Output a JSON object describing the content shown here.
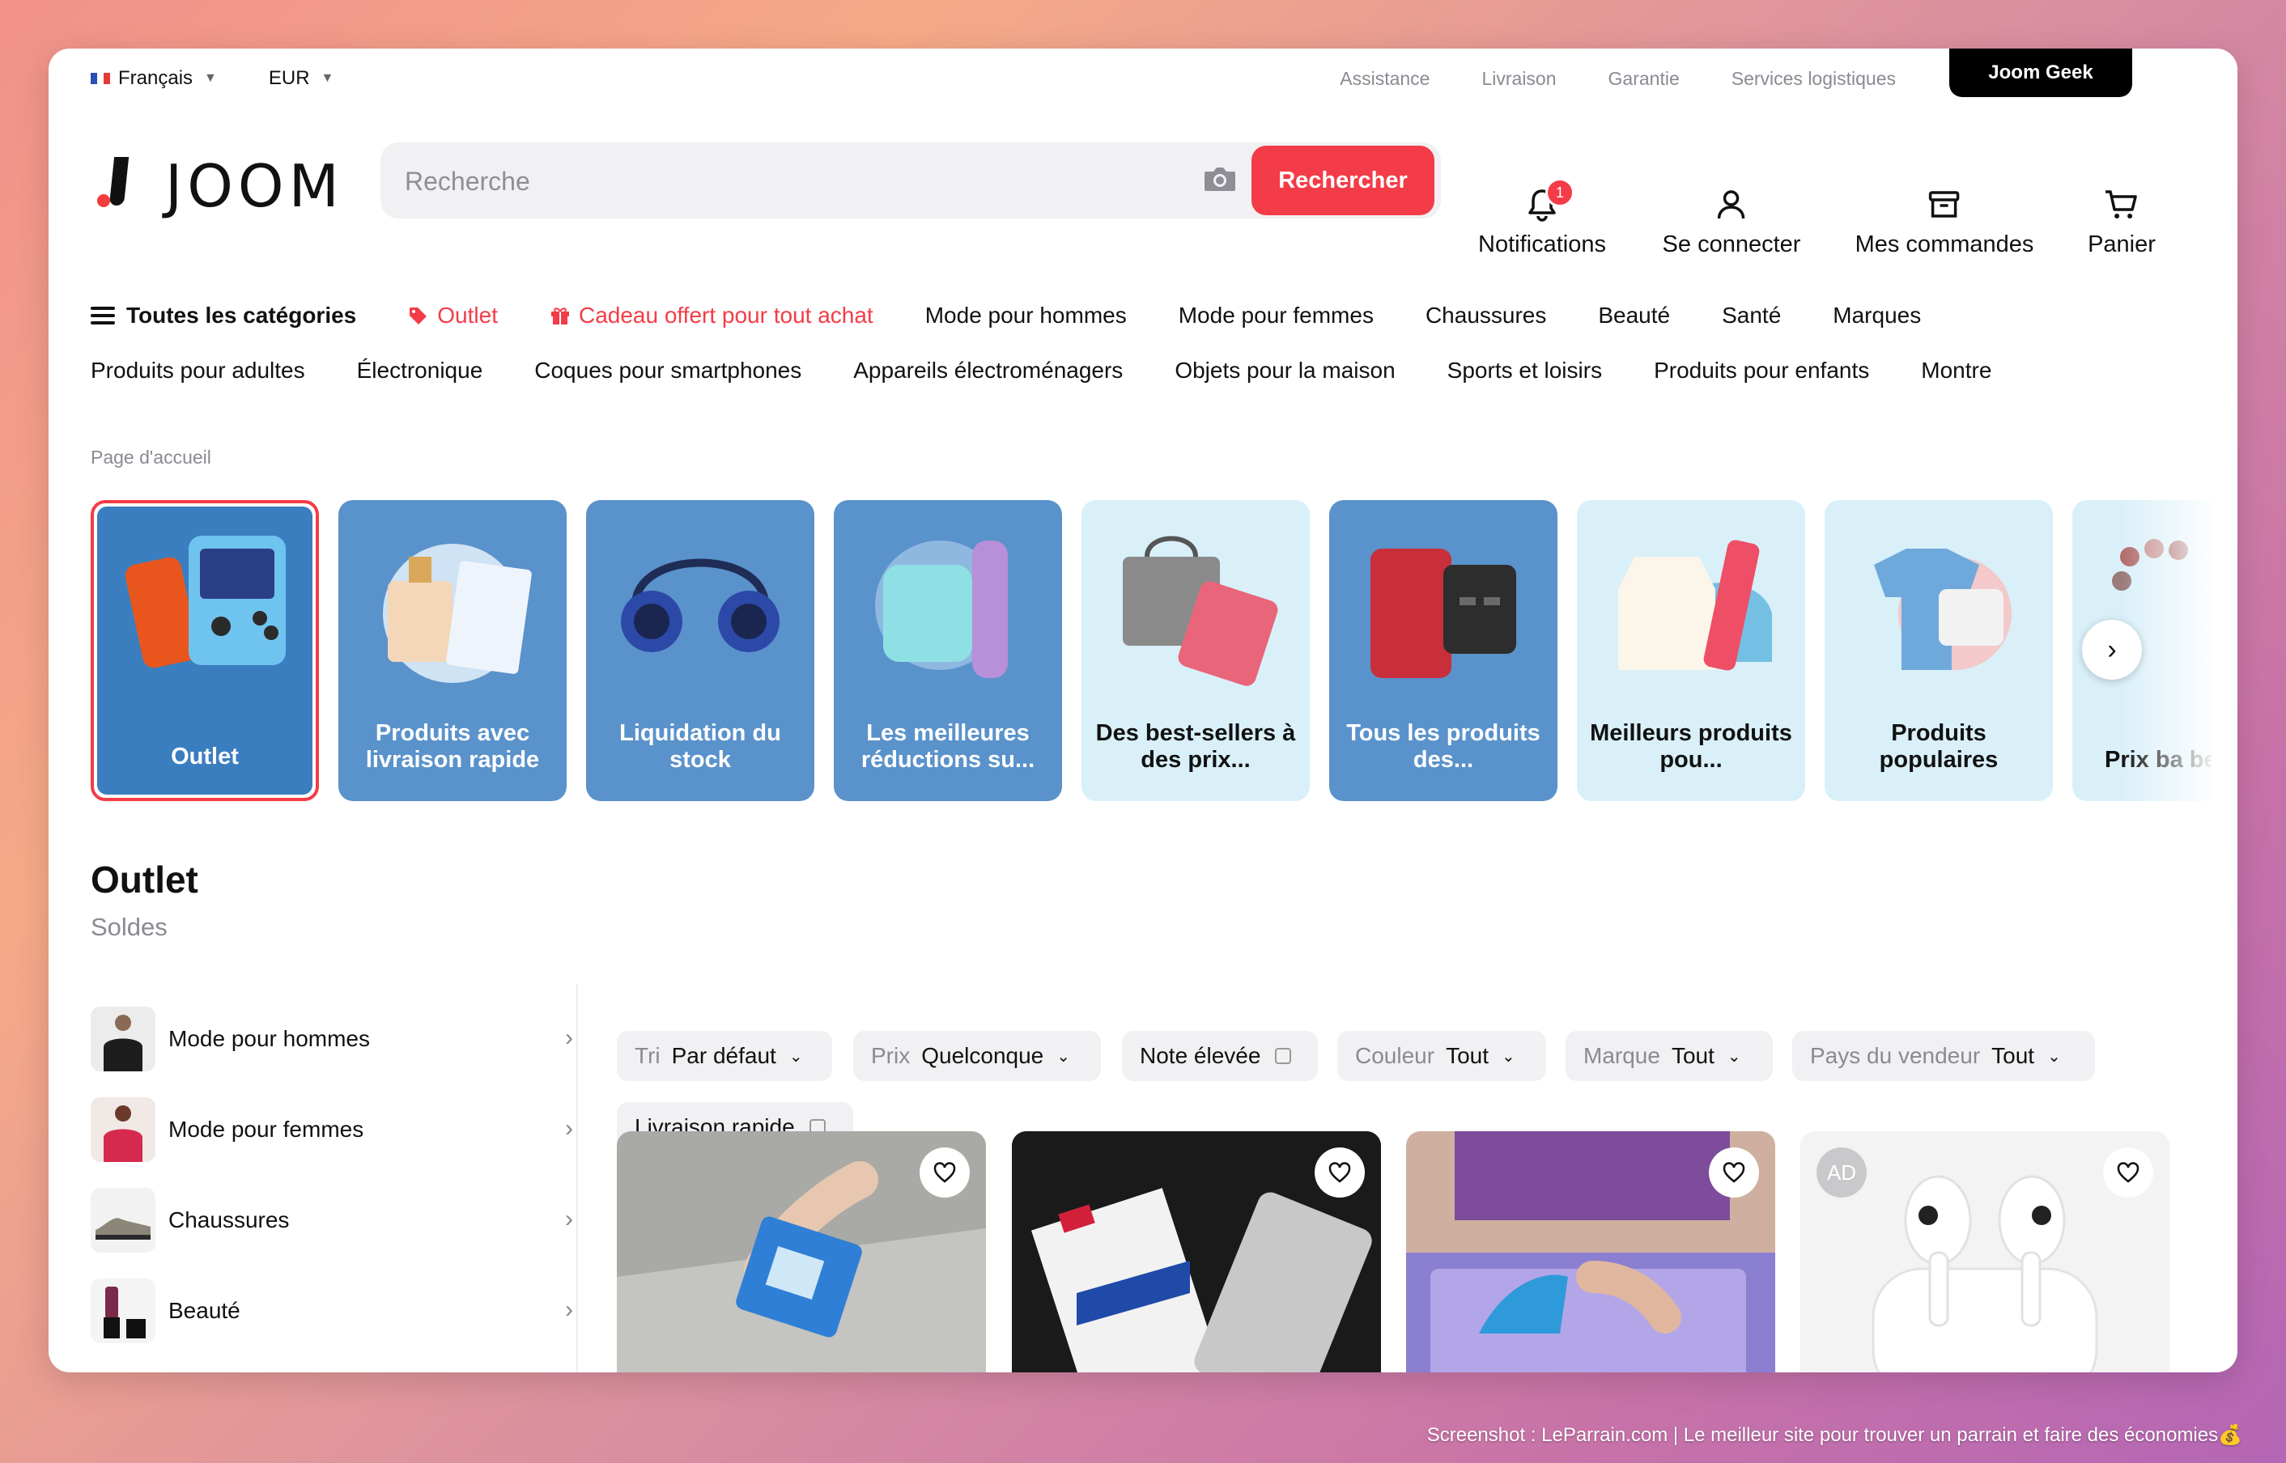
{
  "topbar": {
    "language": "Français",
    "currency": "EUR",
    "links": [
      "Assistance",
      "Livraison",
      "Garantie",
      "Services logistiques"
    ],
    "geek_label": "Joom Geek"
  },
  "header": {
    "logo_text": "JOOM",
    "search_placeholder": "Recherche",
    "search_button": "Rechercher",
    "notifications_label": "Notifications",
    "notifications_count": "1",
    "login_label": "Se connecter",
    "orders_label": "Mes commandes",
    "cart_label": "Panier"
  },
  "nav_row1": {
    "all_categories": "Toutes les catégories",
    "outlet": "Outlet",
    "gift": "Cadeau offert pour tout achat",
    "items": [
      "Mode pour hommes",
      "Mode pour femmes",
      "Chaussures",
      "Beauté",
      "Santé",
      "Marques"
    ]
  },
  "nav_row2": [
    "Produits pour adultes",
    "Électronique",
    "Coques pour smartphones",
    "Appareils électroménagers",
    "Objets pour la maison",
    "Sports et loisirs",
    "Produits pour enfants",
    "Montre"
  ],
  "breadcrumb": "Page d'accueil",
  "tiles": [
    {
      "label": "Outlet",
      "bg": "#3a7ec0",
      "fg": "#ffffff"
    },
    {
      "label": "Produits avec livraison rapide",
      "bg": "#5a92cb",
      "fg": "#ffffff"
    },
    {
      "label": "Liquidation du stock",
      "bg": "#5a92cb",
      "fg": "#ffffff"
    },
    {
      "label": "Les meilleures réductions su...",
      "bg": "#5a92cb",
      "fg": "#ffffff"
    },
    {
      "label": "Des best-sellers à des prix...",
      "bg": "#d9f0f9",
      "fg": "#111111"
    },
    {
      "label": "Tous les produits des...",
      "bg": "#5a92cb",
      "fg": "#ffffff"
    },
    {
      "label": "Meilleurs produits pou...",
      "bg": "#d9f0f9",
      "fg": "#111111"
    },
    {
      "label": "Produits populaires",
      "bg": "#d9f0f9",
      "fg": "#111111"
    },
    {
      "label": "Prix ba best-",
      "bg": "#d9f0f9",
      "fg": "#111111"
    }
  ],
  "outlet": {
    "title": "Outlet",
    "subtitle": "Soldes"
  },
  "sidebar": [
    "Mode pour hommes",
    "Mode pour femmes",
    "Chaussures",
    "Beauté"
  ],
  "filters": {
    "sort_key": "Tri",
    "sort_value": "Par défaut",
    "price_key": "Prix",
    "price_value": "Quelconque",
    "rating": "Note élevée",
    "color_key": "Couleur",
    "color_value": "Tout",
    "brand_key": "Marque",
    "brand_value": "Tout",
    "country_key": "Pays du vendeur",
    "country_value": "Tout",
    "fast": "Livraison rapide"
  },
  "products": {
    "ad_badge": "AD"
  },
  "footer_note": "Screenshot : LeParrain.com | Le meilleur site pour trouver un parrain et faire des économies💰"
}
